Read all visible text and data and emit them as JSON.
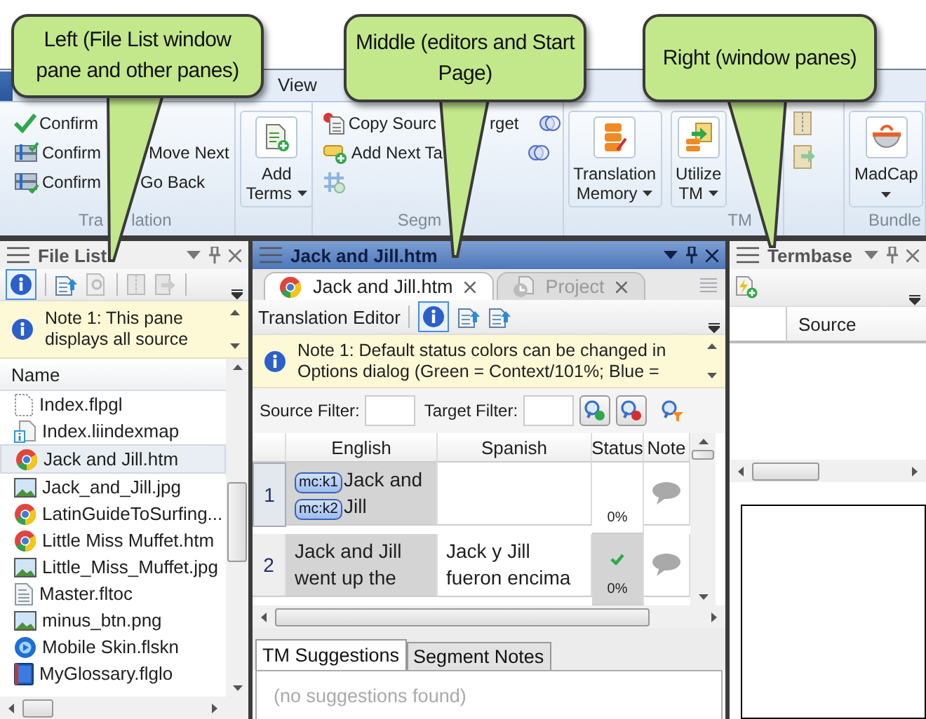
{
  "callouts": [
    {
      "text": "Left (File List window pane and other panes)"
    },
    {
      "text": "Middle (editors and Start Page)"
    },
    {
      "text": "Right (window panes)"
    }
  ],
  "ribbon": {
    "tabs": [
      {
        "label": "View",
        "selected": false
      }
    ],
    "groups": [
      {
        "kind": "translation",
        "label_parts": [
          "Tra",
          "lation"
        ],
        "items": [
          {
            "parts": [
              "Confirm"
            ]
          },
          {
            "parts": [
              "Confirm",
              "Move Next"
            ]
          },
          {
            "parts": [
              "Confirm",
              "Go Back"
            ]
          }
        ]
      },
      {
        "kind": "large",
        "buttons": [
          {
            "lines": [
              "Add",
              "Terms"
            ],
            "dropdown": true
          }
        ]
      },
      {
        "kind": "segment",
        "label_parts": [
          "Segm"
        ],
        "items": [
          {
            "parts": [
              "Copy Sourc",
              "rget"
            ]
          },
          {
            "parts": [
              "Add Next Ta"
            ]
          }
        ]
      },
      {
        "kind": "tm",
        "label_parts": [
          "TM"
        ],
        "buttons": [
          {
            "lines": [
              "Translation",
              "Memory"
            ],
            "dropdown": true
          },
          {
            "lines": [
              "Utilize",
              "TM"
            ],
            "dropdown": true
          }
        ]
      },
      {
        "kind": "bundle",
        "label_parts": [
          "Bundle"
        ]
      },
      {
        "kind": "large",
        "buttons": [
          {
            "lines": [
              "MadCap"
            ],
            "dropdown": true
          }
        ]
      }
    ]
  },
  "left": {
    "title": "File List",
    "note": "Note 1: This pane displays all source",
    "column": "Name",
    "files": [
      {
        "name": "Index.flpgl",
        "kind": "page",
        "selected": false
      },
      {
        "name": "Index.liindexmap",
        "kind": "index",
        "selected": false
      },
      {
        "name": "Jack and Jill.htm",
        "kind": "browser",
        "selected": true
      },
      {
        "name": "Jack_and_Jill.jpg",
        "kind": "image",
        "selected": false
      },
      {
        "name": "LatinGuideToSurfing...",
        "kind": "browser",
        "selected": false
      },
      {
        "name": "Little Miss Muffet.htm",
        "kind": "browser",
        "selected": false
      },
      {
        "name": "Little_Miss_Muffet.jpg",
        "kind": "image",
        "selected": false
      },
      {
        "name": "Master.fltoc",
        "kind": "toc",
        "selected": false
      },
      {
        "name": "minus_btn.png",
        "kind": "image",
        "selected": false
      },
      {
        "name": "Mobile Skin.flskn",
        "kind": "skin",
        "selected": false
      },
      {
        "name": "MyGlossary.flglo",
        "kind": "glossary",
        "selected": false
      }
    ]
  },
  "middle": {
    "title": "Jack and Jill.htm",
    "tabs": [
      {
        "label": "Jack and Jill.htm",
        "kind": "browser",
        "selected": true
      },
      {
        "label": "Project",
        "kind": "project",
        "selected": false
      }
    ],
    "toolbar_label": "Translation Editor",
    "note": "Note 1: Default status colors can be changed in Options dialog (Green = Context/101%; Blue =",
    "source_filter_label": "Source Filter:",
    "target_filter_label": "Target Filter:",
    "columns": [
      "English",
      "Spanish",
      "Status",
      "Note"
    ],
    "segments": [
      {
        "number": "1",
        "source": [
          {
            "tag": "mc:k1",
            "text": "Jack and"
          },
          {
            "tag": "mc:k2",
            "text": "Jill"
          }
        ],
        "status": "0%",
        "confirmed": false,
        "selected": true
      },
      {
        "number": "2",
        "source": [
          {
            "text": "Jack and Jill went up the"
          }
        ],
        "target": "Jack y Jill fueron encima",
        "status": "0%",
        "confirmed": true,
        "selected": false
      }
    ],
    "bottom_tabs": [
      {
        "label": "TM Suggestions",
        "selected": true
      },
      {
        "label": "Segment Notes",
        "selected": false
      }
    ],
    "suggestions": "(no suggestions found)"
  },
  "right": {
    "title": "Termbase",
    "column": "Source"
  }
}
